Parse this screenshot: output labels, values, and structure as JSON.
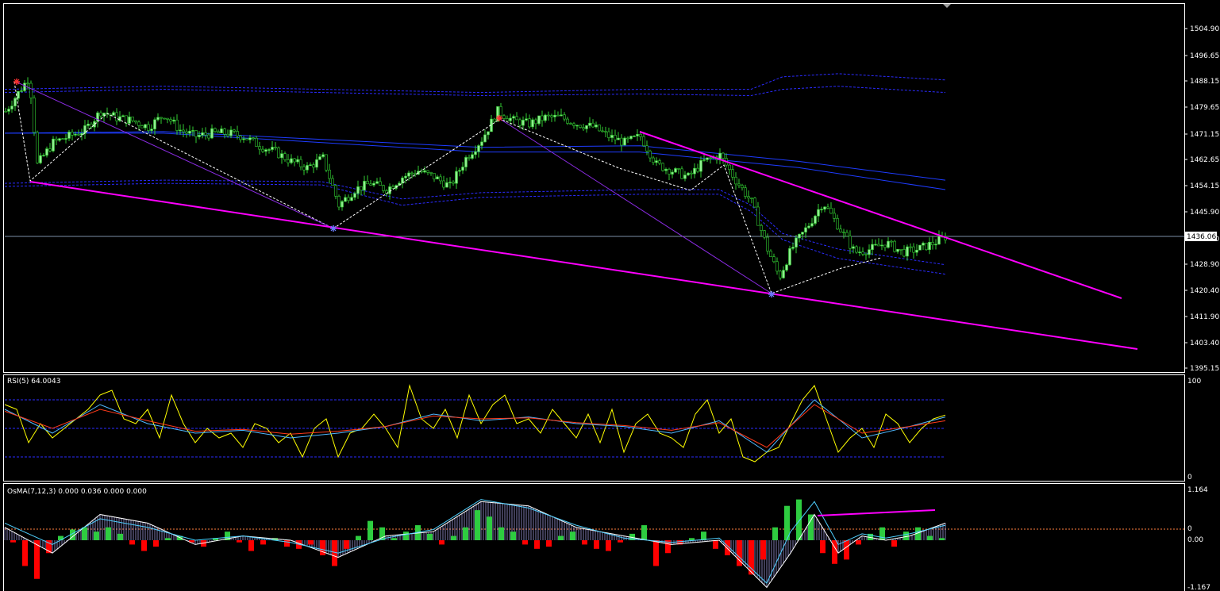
{
  "colors": {
    "background": "#000000",
    "frame": "#ffffff",
    "candle_up": "#90ee90",
    "candle_down": "#000000",
    "candle_wick": "#32cd32",
    "ma": "#1e3cff",
    "envelope": "#2b2bff",
    "trend": "#ff00ff",
    "channel": "#8a2be2",
    "zigzag": "#ffffff",
    "bid_line": "#7b8fa6",
    "rsi_main": "#ffff00",
    "rsi_fast": "#4fb8ff",
    "rsi_slow": "#ff3a1a",
    "rsi_level": "#2b2bff",
    "osma_pos": "#2ecc40",
    "osma_neg": "#ff0000",
    "osma_hatch": "#b8b0ff",
    "osma_line_white": "#ffffff",
    "osma_line_cyan": "#4fd0ff",
    "osma_zero": "#ff8040"
  },
  "price_axis": {
    "ticks": [
      "1504.90",
      "1496.65",
      "1488.15",
      "1479.65",
      "1471.15",
      "1462.65",
      "1454.15",
      "1445.90",
      "1437.40",
      "1428.90",
      "1420.40",
      "1411.90",
      "1403.40",
      "1395.15"
    ],
    "current": "1436.06"
  },
  "rsi": {
    "title": "RSI(5) 64.0043",
    "ticks": [
      "100",
      "0"
    ]
  },
  "osma": {
    "title": "OsMA(7,12,3) 0.000 0.036 0.000 0.000",
    "ticks": [
      "1.164",
      "0",
      "0.00",
      "-1.167"
    ]
  },
  "chart_data": [
    {
      "type": "candlestick",
      "ylim": [
        1393.0,
        1510.0
      ],
      "x": [
        0,
        30,
        40,
        60,
        80,
        100,
        120,
        140,
        160,
        180,
        200,
        220,
        240,
        260,
        280,
        300,
        320,
        340,
        360,
        380,
        400,
        420,
        440,
        460,
        480,
        500,
        520,
        540,
        560,
        580,
        600,
        620,
        640,
        660,
        680,
        700,
        720,
        740,
        760,
        780,
        800,
        820,
        840,
        860,
        880,
        900,
        920,
        940,
        960,
        975,
        990,
        1010,
        1030,
        1050,
        1070,
        1090,
        1110,
        1130,
        1150,
        1170,
        1185
      ],
      "close": [
        1476.0,
        1487.0,
        1459.0,
        1466.0,
        1468.0,
        1470.0,
        1476.0,
        1474.0,
        1473.0,
        1471.0,
        1475.0,
        1470.0,
        1468.0,
        1469.0,
        1469.0,
        1468.0,
        1465.0,
        1463.0,
        1460.0,
        1458.0,
        1461.0,
        1446.0,
        1451.0,
        1453.0,
        1451.0,
        1455.0,
        1457.0,
        1455.0,
        1452.0,
        1461.0,
        1467.0,
        1476.0,
        1473.0,
        1472.0,
        1474.0,
        1474.0,
        1472.0,
        1471.0,
        1468.0,
        1466.0,
        1468.0,
        1459.0,
        1457.0,
        1455.0,
        1460.0,
        1462.0,
        1454.0,
        1447.0,
        1432.0,
        1423.0,
        1432.0,
        1439.0,
        1447.0,
        1439.0,
        1431.0,
        1432.0,
        1434.0,
        1431.0,
        1432.0,
        1434.0,
        1436.06
      ],
      "ma_series": [
        {
          "x": [
            0,
            200,
            400,
            600,
            800,
            1000,
            1185
          ],
          "values": [
            1469.0,
            1469.5,
            1467.0,
            1464.5,
            1465.0,
            1460.0,
            1454.0
          ]
        },
        {
          "x": [
            0,
            200,
            400,
            600,
            800,
            1000,
            1185
          ],
          "values": [
            1469.0,
            1469.0,
            1466.0,
            1463.0,
            1463.0,
            1458.0,
            1451.0
          ]
        }
      ],
      "envelope_upper": {
        "x": [
          0,
          200,
          400,
          600,
          800,
          940,
          980,
          1050,
          1185
        ],
        "values": [
          1483.0,
          1484.0,
          1483.0,
          1482.0,
          1483.0,
          1483.0,
          1487.0,
          1488.0,
          1486.0
        ]
      },
      "envelope_upper2": {
        "x": [
          0,
          200,
          400,
          600,
          800,
          940,
          980,
          1050,
          1185
        ],
        "values": [
          1482.0,
          1483.0,
          1482.0,
          1481.0,
          1481.5,
          1481.0,
          1483.0,
          1484.0,
          1482.0
        ]
      },
      "envelope_lower": {
        "x": [
          0,
          200,
          400,
          500,
          600,
          800,
          900,
          940,
          980,
          1050,
          1185
        ],
        "values": [
          1453.0,
          1454.0,
          1453.5,
          1448.0,
          1450.0,
          1451.0,
          1451.0,
          1446.0,
          1437.0,
          1432.0,
          1427.0
        ]
      },
      "envelope_lower2": {
        "x": [
          0,
          200,
          400,
          500,
          600,
          800,
          900,
          940,
          980,
          1050,
          1185
        ],
        "values": [
          1452.0,
          1453.0,
          1452.5,
          1446.0,
          1448.5,
          1449.5,
          1449.5,
          1444.0,
          1435.0,
          1429.0,
          1424.0
        ]
      },
      "bid": 1436.06
    },
    {
      "type": "line",
      "ylim": [
        0,
        100
      ],
      "levels": [
        80,
        50,
        20
      ],
      "series": [
        {
          "x": [
            0,
            15,
            30,
            45,
            60,
            75,
            90,
            105,
            120,
            135,
            150,
            165,
            180,
            195,
            210,
            225,
            240,
            255,
            270,
            285,
            300,
            315,
            330,
            345,
            360,
            375,
            390,
            405,
            420,
            435,
            450,
            465,
            480,
            495,
            510,
            525,
            540,
            555,
            570,
            585,
            600,
            615,
            630,
            645,
            660,
            675,
            690,
            705,
            720,
            735,
            750,
            765,
            780,
            795,
            810,
            825,
            840,
            855,
            870,
            885,
            900,
            915,
            930,
            945,
            960,
            975,
            990,
            1005,
            1020,
            1035,
            1050,
            1065,
            1080,
            1095,
            1110,
            1125,
            1140,
            1155,
            1170,
            1185
          ],
          "values": [
            75,
            70,
            35,
            55,
            40,
            50,
            60,
            70,
            85,
            90,
            60,
            55,
            70,
            40,
            85,
            55,
            35,
            50,
            40,
            45,
            30,
            55,
            50,
            35,
            45,
            20,
            50,
            60,
            20,
            45,
            50,
            65,
            50,
            30,
            95,
            60,
            50,
            70,
            40,
            85,
            55,
            75,
            85,
            55,
            60,
            45,
            70,
            55,
            40,
            65,
            35,
            70,
            25,
            55,
            65,
            45,
            40,
            30,
            65,
            80,
            45,
            60,
            20,
            15,
            25,
            30,
            55,
            80,
            95,
            60,
            25,
            40,
            50,
            30,
            65,
            55,
            35,
            50,
            60,
            64
          ]
        },
        {
          "x": [
            0,
            60,
            120,
            180,
            240,
            300,
            360,
            420,
            480,
            540,
            600,
            660,
            720,
            780,
            840,
            900,
            960,
            1020,
            1080,
            1140,
            1185
          ],
          "values": [
            70,
            45,
            75,
            55,
            45,
            48,
            40,
            45,
            52,
            65,
            58,
            62,
            55,
            52,
            45,
            58,
            25,
            80,
            40,
            52,
            62
          ]
        },
        {
          "x": [
            0,
            60,
            120,
            180,
            240,
            300,
            360,
            420,
            480,
            540,
            600,
            660,
            720,
            780,
            840,
            900,
            960,
            1020,
            1080,
            1140,
            1185
          ],
          "values": [
            68,
            50,
            70,
            58,
            47,
            49,
            44,
            47,
            52,
            63,
            60,
            61,
            56,
            53,
            48,
            56,
            30,
            75,
            45,
            52,
            58
          ]
        }
      ]
    },
    {
      "type": "bar",
      "ylim": [
        -1.167,
        1.164
      ],
      "x": [
        10,
        25,
        40,
        55,
        70,
        85,
        100,
        115,
        130,
        145,
        160,
        175,
        190,
        205,
        220,
        235,
        250,
        265,
        280,
        295,
        310,
        325,
        340,
        355,
        370,
        385,
        400,
        415,
        430,
        445,
        460,
        475,
        490,
        505,
        520,
        535,
        550,
        565,
        580,
        595,
        610,
        625,
        640,
        655,
        670,
        685,
        700,
        715,
        730,
        745,
        760,
        775,
        790,
        805,
        820,
        835,
        850,
        865,
        880,
        895,
        910,
        925,
        940,
        955,
        970,
        985,
        1000,
        1015,
        1030,
        1045,
        1060,
        1075,
        1090,
        1105,
        1120,
        1135,
        1150,
        1165,
        1180
      ],
      "values": [
        -0.05,
        -0.6,
        -0.9,
        -0.3,
        0.1,
        0.25,
        0.3,
        0.2,
        0.3,
        0.15,
        -0.1,
        -0.25,
        -0.15,
        0.05,
        0.1,
        -0.05,
        -0.15,
        0.05,
        0.2,
        -0.05,
        -0.25,
        -0.1,
        0.05,
        -0.15,
        -0.2,
        -0.1,
        -0.35,
        -0.6,
        -0.2,
        0.1,
        0.45,
        0.3,
        0.05,
        0.2,
        0.35,
        0.15,
        -0.1,
        0.1,
        0.3,
        0.7,
        0.55,
        0.3,
        0.2,
        -0.1,
        -0.2,
        -0.15,
        0.1,
        0.2,
        -0.1,
        -0.2,
        -0.25,
        -0.05,
        0.15,
        0.35,
        -0.6,
        -0.3,
        -0.1,
        0.05,
        0.2,
        -0.2,
        -0.35,
        -0.6,
        -0.8,
        -0.45,
        0.3,
        0.8,
        0.95,
        0.6,
        -0.3,
        -0.55,
        -0.45,
        -0.1,
        0.15,
        0.3,
        -0.15,
        0.2,
        0.3,
        0.1,
        0.05
      ],
      "series": [
        {
          "x": [
            0,
            60,
            120,
            180,
            240,
            300,
            360,
            420,
            480,
            540,
            600,
            660,
            720,
            780,
            840,
            900,
            960,
            990,
            1020,
            1050,
            1080,
            1110,
            1140,
            1185
          ],
          "values": [
            0.3,
            -0.3,
            0.6,
            0.4,
            -0.1,
            0.1,
            0.0,
            -0.4,
            0.1,
            0.2,
            0.9,
            0.8,
            0.3,
            0.1,
            -0.1,
            0.0,
            -1.1,
            -0.3,
            0.6,
            -0.3,
            0.1,
            0.0,
            0.1,
            0.4
          ]
        },
        {
          "x": [
            0,
            60,
            120,
            180,
            240,
            300,
            360,
            420,
            480,
            540,
            600,
            660,
            720,
            780,
            840,
            900,
            960,
            990,
            1020,
            1050,
            1080,
            1110,
            1140,
            1185
          ],
          "values": [
            0.4,
            -0.1,
            0.5,
            0.3,
            0.0,
            0.1,
            -0.05,
            -0.3,
            0.05,
            0.25,
            0.95,
            0.75,
            0.35,
            0.05,
            -0.05,
            0.05,
            -1.0,
            0.2,
            0.9,
            -0.1,
            0.15,
            0.05,
            0.15,
            0.35
          ]
        }
      ]
    }
  ]
}
